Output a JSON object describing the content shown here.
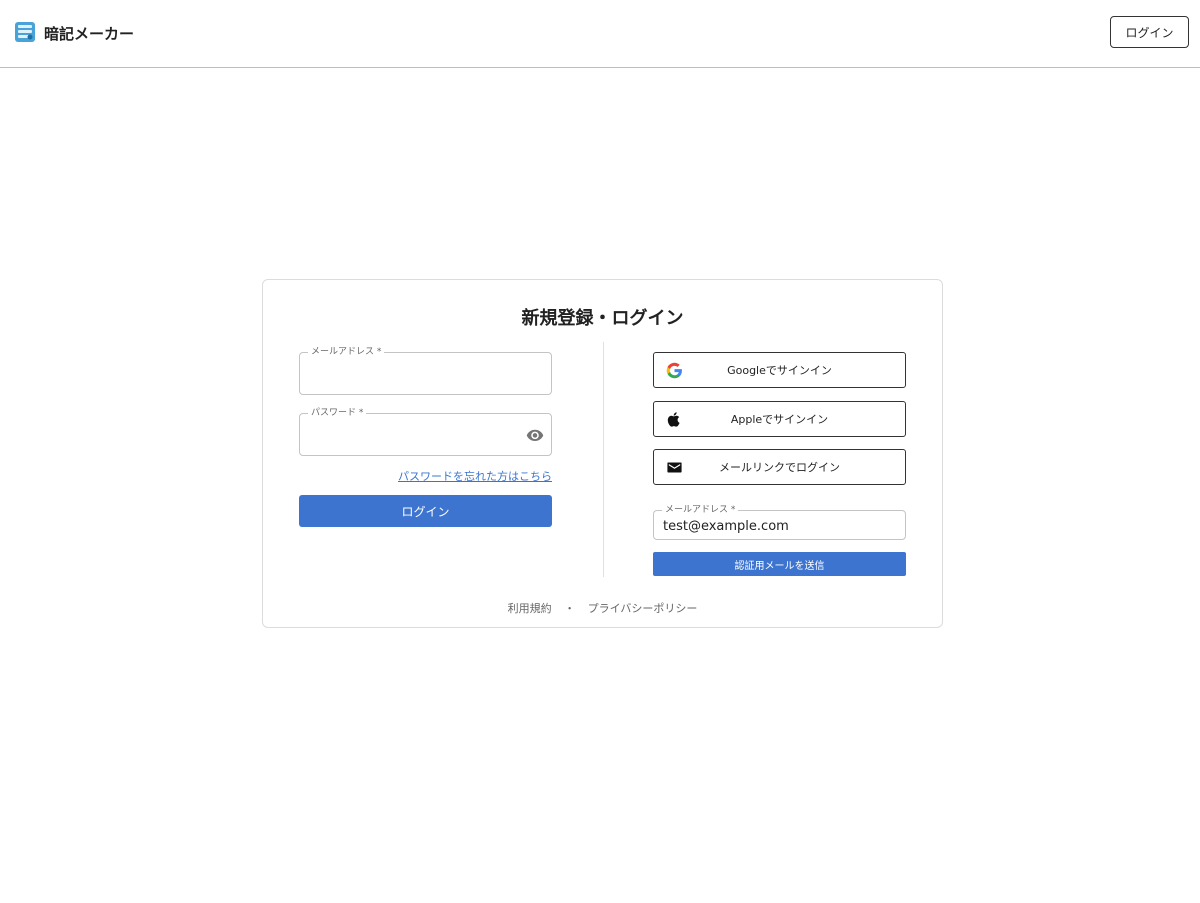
{
  "header": {
    "app_name": "暗記メーカー",
    "login_label": "ログイン",
    "logo_icon": "notebook-stack-icon"
  },
  "card": {
    "title": "新規登録・ログイン",
    "left": {
      "email_label": "メールアドレス *",
      "email_value": "",
      "password_label": "パスワード *",
      "password_value": "",
      "forgot_link": "パスワードを忘れた方はこちら",
      "login_button": "ログイン"
    },
    "right": {
      "google_button": "Googleでサインイン",
      "apple_button": "Appleでサインイン",
      "mail_link_button": "メールリンクでログイン",
      "email_label": "メールアドレス *",
      "email_value": "test@example.com",
      "send_button": "認証用メールを送信"
    },
    "footer": {
      "terms": "利用規約",
      "separator": "・",
      "privacy": "プライバシーポリシー"
    }
  },
  "colors": {
    "accent": "#3d74d0",
    "link": "#3b74d0",
    "border": "#c4c4c4"
  }
}
